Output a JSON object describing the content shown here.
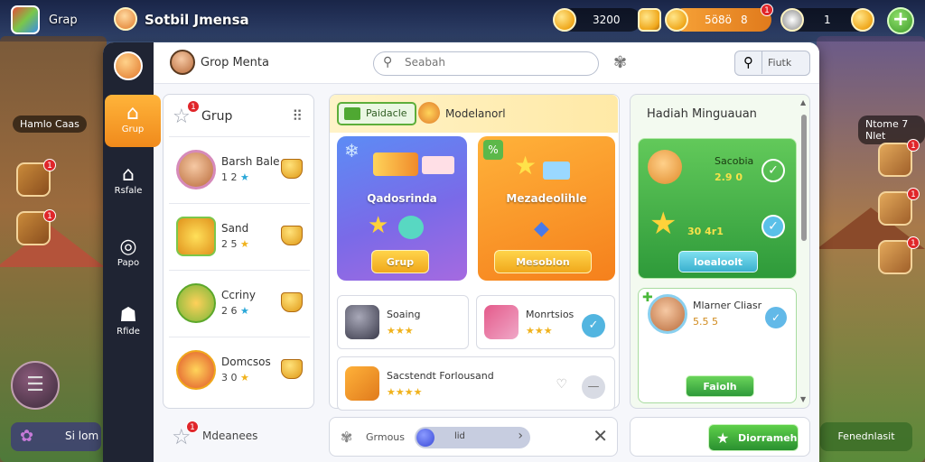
{
  "topbar": {
    "left_label": "Grap",
    "player_name": "Sotbil Jmensa",
    "currency_1": "3200",
    "currency_2": "5ö8ö",
    "currency_2_suffix": "8",
    "currency_3": "1",
    "plus_label": "+"
  },
  "background": {
    "left_label": "Hamlo Caas",
    "right_label": "Ntome 7 Nlet",
    "bottom_left_label": "Si lom",
    "bottom_right_label": "Fenednlasit",
    "badge_1": "1"
  },
  "sidebar": {
    "items": [
      {
        "label": "Grup",
        "icon": "house-icon"
      },
      {
        "label": "Rsfale",
        "icon": "home-icon"
      },
      {
        "label": "Papo",
        "icon": "compass-icon"
      },
      {
        "label": "Rfide",
        "icon": "ghost-icon"
      }
    ]
  },
  "header": {
    "title": "Grop Menta",
    "search_placeholder": "Seabah",
    "search_button_label": "Fiutk"
  },
  "group_panel": {
    "title": "Grup",
    "badge": "1",
    "items": [
      {
        "name": "Barsh Bale",
        "rating": "1 2"
      },
      {
        "name": "Sand",
        "rating": "2 5"
      },
      {
        "name": "Ccriny",
        "rating": "2 6"
      },
      {
        "name": "Domcsos",
        "rating": "3 0"
      }
    ],
    "footer_label": "Mdeanees",
    "footer_badge": "1"
  },
  "middle_panel": {
    "tab_label": "Paidacle",
    "sub_title": "Modelanorl",
    "card_a": {
      "title": "Qadosrinda",
      "button": "Grup"
    },
    "card_b": {
      "title": "Mezadeolihle",
      "button": "Mesoblon"
    },
    "rows": [
      {
        "name": "Soaing",
        "stars": "★★★"
      },
      {
        "name": "Monrtsios",
        "stars": "★★★"
      },
      {
        "name": "Sacstendt Forlousand",
        "stars": "★★★★"
      }
    ],
    "footer": {
      "text": "Grmous",
      "value": "lid",
      "close": "✕"
    }
  },
  "right_panel": {
    "title": "Hadiah Minguauan",
    "green_card": {
      "row_1": {
        "name": "Sacobia",
        "value": "2.9 0"
      },
      "row_2": {
        "name": "",
        "value": "30 4r1"
      },
      "button": "loealoolt"
    },
    "white_card": {
      "name": "Mlarner Cliasr",
      "value": "5.5 5",
      "button": "Faiolh"
    },
    "footer_button": "Diorrameh"
  },
  "colors": {
    "accent_orange": "#f7941d",
    "accent_green": "#3fae3a",
    "rail_dark": "#1f2433"
  }
}
